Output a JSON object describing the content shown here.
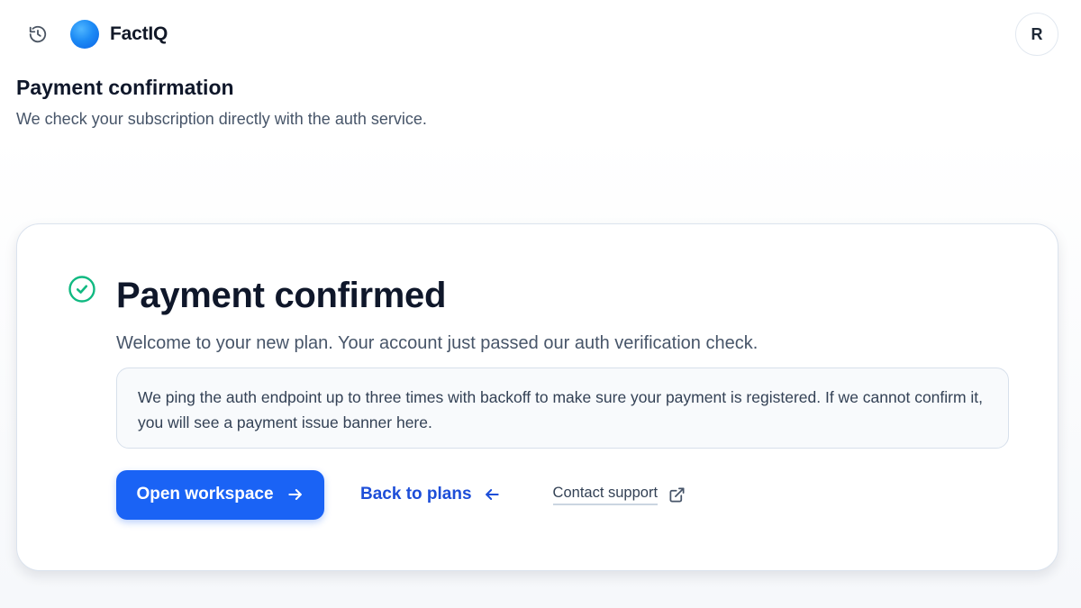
{
  "header": {
    "history_icon": "history-icon",
    "brand_name": "FactIQ",
    "avatar_initial": "R"
  },
  "page": {
    "title": "Payment confirmation",
    "subtitle": "We check your subscription directly with the auth service."
  },
  "card": {
    "status_icon": "check-circle-icon",
    "title": "Payment confirmed",
    "subtitle": "Welcome to your new plan. Your account just passed our auth verification check.",
    "info_text": "We ping the auth endpoint up to three times with backoff to make sure your payment is registered. If we cannot confirm it, you will see a payment issue banner here.",
    "actions": {
      "primary_label": "Open workspace",
      "secondary_label": "Back to plans",
      "support_label": "Contact support"
    }
  },
  "colors": {
    "accent": "#1a63f5",
    "link": "#1d4ed8",
    "success": "#10b981",
    "text_primary": "#0f172a",
    "text_muted": "#475569"
  }
}
